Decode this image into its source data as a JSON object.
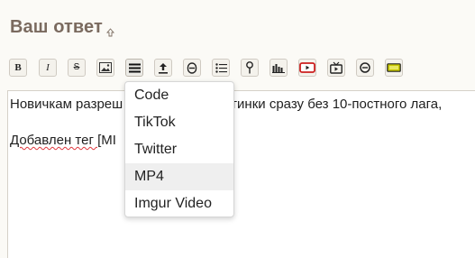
{
  "section": {
    "title": "Ваш ответ"
  },
  "toolbar": {
    "bold_label": "B",
    "italic_label": "I",
    "strike_label": "S",
    "buttons": [
      "bold-icon",
      "italic-icon",
      "strikethrough-icon",
      "image-icon",
      "menu-icon",
      "upload-icon",
      "spoiler-icon",
      "list-icon",
      "pin-icon",
      "chart-bars-icon",
      "youtube-icon",
      "tv-icon",
      "minus-circle-icon",
      "battery-icon"
    ],
    "accent_colors": {
      "youtube": "#cc1f1f",
      "battery": "#c8c800"
    }
  },
  "editor": {
    "line1": "Новичкам разреш",
    "line1_rest": "ртинки сразу без 10-постного лага,",
    "line2_start": "Добавлен тег [",
    "line2_marked": "MI"
  },
  "dropdown": {
    "items": [
      "Code",
      "TikTok",
      "Twitter",
      "MP4",
      "Imgur Video"
    ],
    "selected": "MP4"
  }
}
